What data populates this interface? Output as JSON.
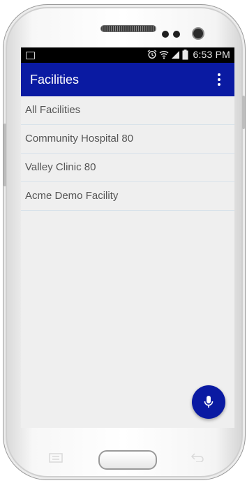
{
  "status_bar": {
    "time": "6:53 PM"
  },
  "app_bar": {
    "title": "Facilities",
    "overflow_icon": "overflow-menu-icon"
  },
  "facilities": [
    {
      "label": "All Facilities"
    },
    {
      "label": "Community Hospital 80"
    },
    {
      "label": "Valley Clinic 80"
    },
    {
      "label": "Acme Demo Facility"
    }
  ],
  "fab": {
    "icon": "microphone-icon",
    "color": "#0a1aa2"
  },
  "colors": {
    "primary": "#0a1aa2",
    "background": "#efefef",
    "divider": "#d8e2ea"
  }
}
